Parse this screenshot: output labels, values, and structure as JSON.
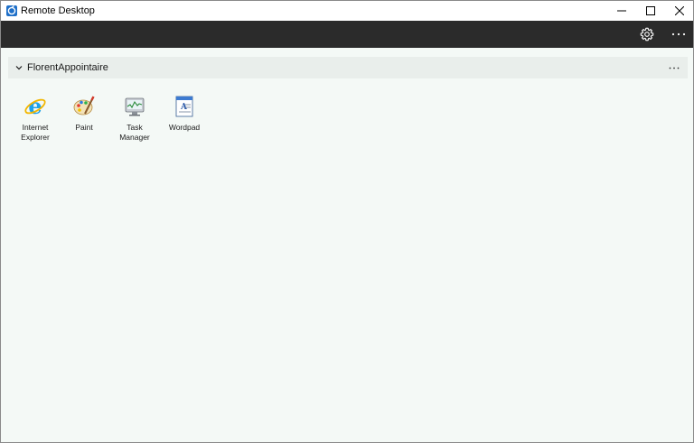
{
  "window": {
    "title": "Remote Desktop",
    "icon": "remote-desktop-icon"
  },
  "window_controls": {
    "minimize": "minimize-icon",
    "maximize": "maximize-icon",
    "close": "close-icon"
  },
  "toolbar": {
    "settings_icon": "gear-icon",
    "more_label": "···"
  },
  "workspace": {
    "name": "FlorentAppointaire",
    "more_label": "···",
    "apps": [
      {
        "label": "Internet Explorer",
        "icon": "internet-explorer-icon"
      },
      {
        "label": "Paint",
        "icon": "paint-icon"
      },
      {
        "label": "Task Manager",
        "icon": "task-manager-icon"
      },
      {
        "label": "Wordpad",
        "icon": "wordpad-icon"
      }
    ]
  },
  "colors": {
    "toolbar_bg": "#2b2b2b",
    "page_bg": "#f4f9f6",
    "group_header_bg": "#e9eeeb"
  }
}
